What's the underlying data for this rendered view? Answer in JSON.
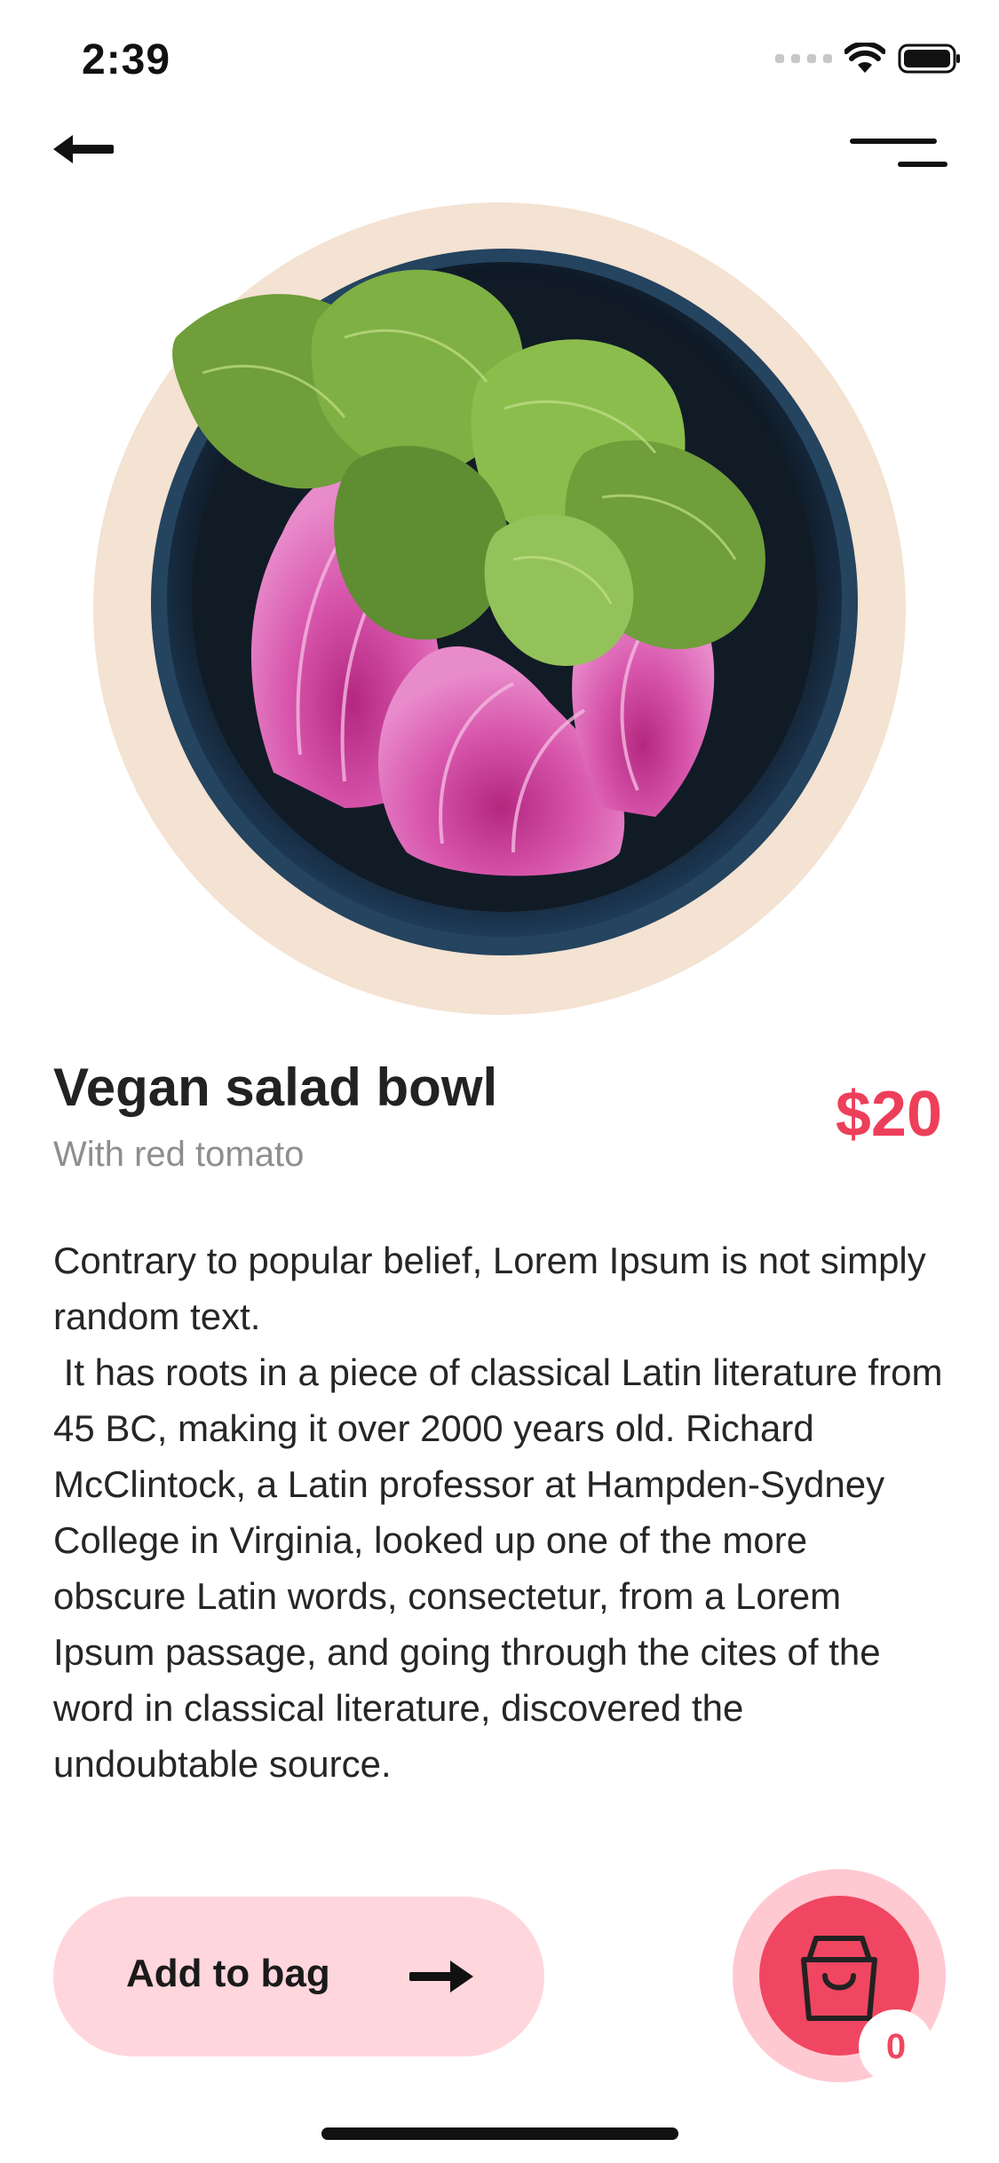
{
  "status_bar": {
    "time": "2:39",
    "icons": [
      "signal-dots-icon",
      "wifi-icon",
      "battery-icon"
    ]
  },
  "navigation": {
    "back_icon": "arrow-left-icon",
    "menu_icon": "menu-icon"
  },
  "product": {
    "image": "salad-bowl-image",
    "name": "Vegan salad bowl",
    "subtitle": "With red tomato",
    "price": "$20",
    "description": "Contrary to popular belief, Lorem Ipsum is not simply random text.\n It has roots in a piece of classical Latin literature from 45 BC, making it over 2000 years old. Richard McClintock, a Latin professor at Hampden-Sydney College in Virginia, looked up one of the more obscure Latin words, consectetur, from a Lorem Ipsum passage, and going through the cites of the word in classical literature, discovered the undoubtable source."
  },
  "actions": {
    "add_to_bag_label": "Add to bag",
    "add_icon": "arrow-right-icon",
    "cart_icon": "shopping-bag-icon",
    "cart_count": "0"
  },
  "colors": {
    "accent": "#ee3f5a",
    "hero_background": "#f4e2d2",
    "button_background": "#ffd6dc",
    "cart_ring": "#ffc9d1",
    "cart_fill": "#f04661"
  }
}
